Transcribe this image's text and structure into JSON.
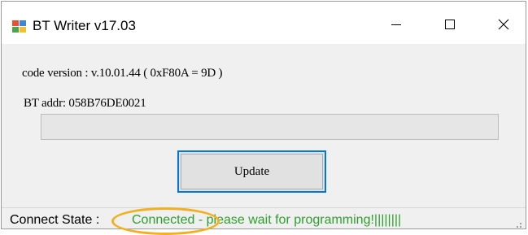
{
  "window": {
    "title": "BT Writer v17.03",
    "icon": "bt-writer-app-icon",
    "controls": {
      "minimize_icon": "minimize-icon",
      "maximize_icon": "maximize-icon",
      "close_icon": "close-icon"
    }
  },
  "info": {
    "code_version": "code version : v.10.01.44 ( 0xF80A = 9D )",
    "bt_addr": "BT addr: 058B76DE0021"
  },
  "progress": {
    "value": 0
  },
  "actions": {
    "update_label": "Update"
  },
  "status": {
    "label": "Connect State :",
    "value": "Connected - please wait for programming!||||||||",
    "value_color": "#2f9e2f"
  },
  "colors": {
    "accent": "#0078d7",
    "highlight": "#f3b01e"
  }
}
